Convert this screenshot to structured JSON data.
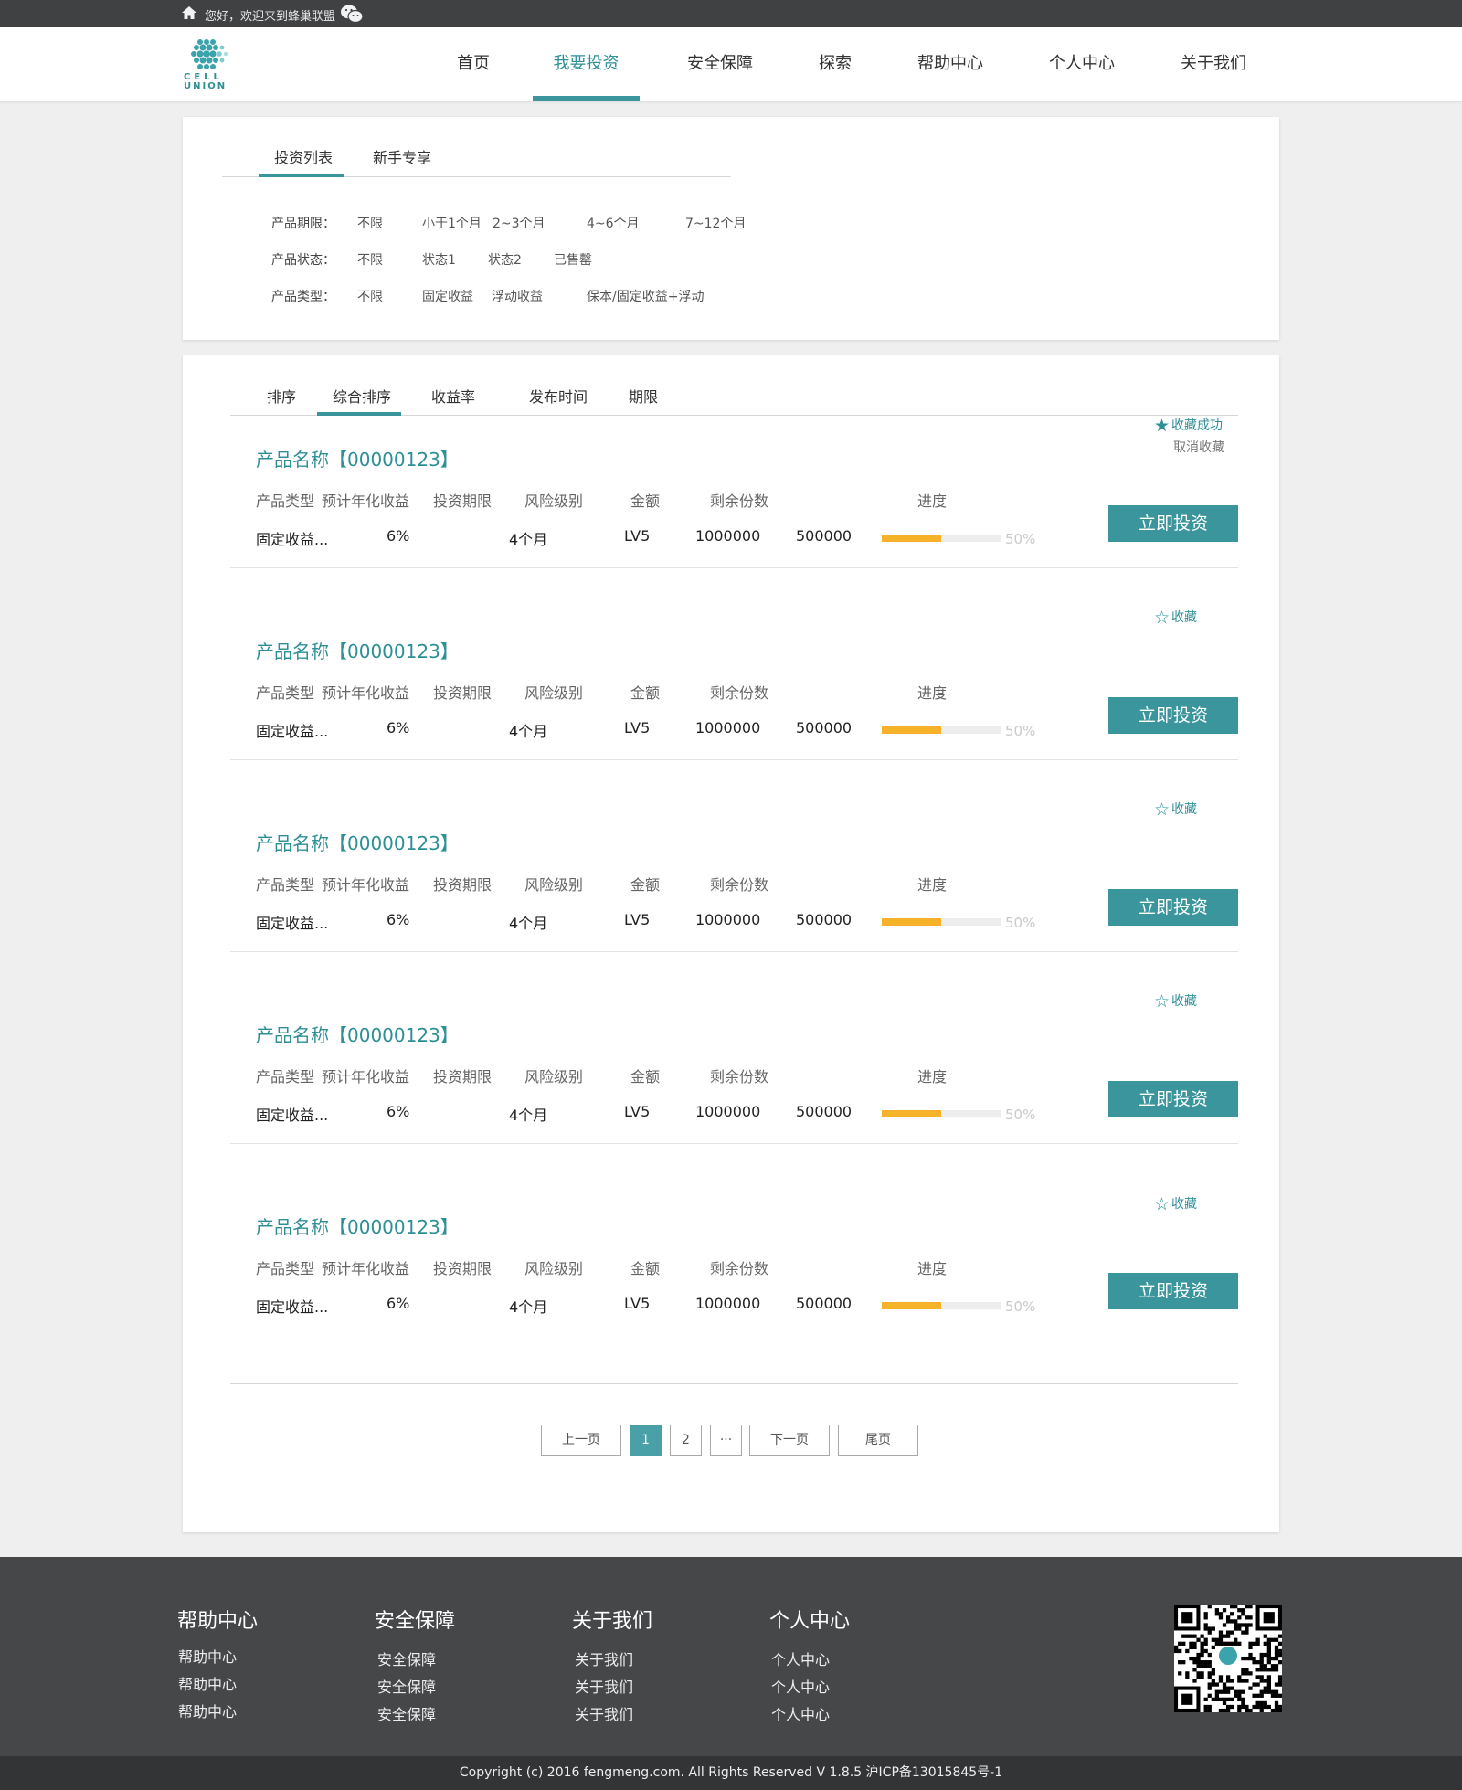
{
  "topbar": {
    "welcome": "您好，欢迎来到蜂巢联盟"
  },
  "logo": {
    "line1": "CELL",
    "line2": "UNION"
  },
  "nav": [
    {
      "label": "首页"
    },
    {
      "label": "我要投资"
    },
    {
      "label": "安全保障"
    },
    {
      "label": "探索"
    },
    {
      "label": "帮助中心"
    },
    {
      "label": "个人中心"
    },
    {
      "label": "关于我们"
    }
  ],
  "filter": {
    "tabs": [
      "投资列表",
      "新手专享"
    ],
    "rows": [
      {
        "label": "产品期限：",
        "options": [
          "不限",
          "小于1个月",
          "2~3个月",
          "4~6个月",
          "7~12个月"
        ]
      },
      {
        "label": "产品状态：",
        "options": [
          "不限",
          "状态1",
          "状态2",
          "已售罄"
        ]
      },
      {
        "label": "产品类型：",
        "options": [
          "不限",
          "固定收益",
          "浮动收益",
          "保本/固定收益+浮动"
        ]
      }
    ]
  },
  "sort": {
    "tabs": [
      "排序",
      "综合排序",
      "收益率",
      "发布时间",
      "期限"
    ]
  },
  "columns": [
    "产品类型",
    "预计年化收益",
    "投资期限",
    "风险级别",
    "金额",
    "剩余份数",
    "进度"
  ],
  "favorite": {
    "collected": "收藏成功",
    "cancel": "取消收藏",
    "label": "收藏"
  },
  "invest_label": "立即投资",
  "products": [
    {
      "title": "产品名称【00000123】",
      "type": "固定收益...",
      "rate": "6%",
      "term": "4个月",
      "risk": "LV5",
      "amount": "1000000",
      "remaining": "500000",
      "progress": 0.5,
      "progress_text": "50%",
      "favorited": true
    },
    {
      "title": "产品名称【00000123】",
      "type": "固定收益...",
      "rate": "6%",
      "term": "4个月",
      "risk": "LV5",
      "amount": "1000000",
      "remaining": "500000",
      "progress": 0.5,
      "progress_text": "50%",
      "favorited": false
    },
    {
      "title": "产品名称【00000123】",
      "type": "固定收益...",
      "rate": "6%",
      "term": "4个月",
      "risk": "LV5",
      "amount": "1000000",
      "remaining": "500000",
      "progress": 0.5,
      "progress_text": "50%",
      "favorited": false
    },
    {
      "title": "产品名称【00000123】",
      "type": "固定收益...",
      "rate": "6%",
      "term": "4个月",
      "risk": "LV5",
      "amount": "1000000",
      "remaining": "500000",
      "progress": 0.5,
      "progress_text": "50%",
      "favorited": false
    },
    {
      "title": "产品名称【00000123】",
      "type": "固定收益...",
      "rate": "6%",
      "term": "4个月",
      "risk": "LV5",
      "amount": "1000000",
      "remaining": "500000",
      "progress": 0.5,
      "progress_text": "50%",
      "favorited": false
    }
  ],
  "pagination": {
    "prev": "上一页",
    "page1": "1",
    "page2": "2",
    "ellipsis": "···",
    "next": "下一页",
    "last": "尾页"
  },
  "footer": {
    "columns": [
      {
        "title": "帮助中心",
        "links": [
          "帮助中心",
          "帮助中心",
          "帮助中心"
        ]
      },
      {
        "title": "安全保障",
        "links": [
          "安全保障",
          "安全保障",
          "安全保障"
        ]
      },
      {
        "title": "关于我们",
        "links": [
          "关于我们",
          "关于我们",
          "关于我们"
        ]
      },
      {
        "title": "个人中心",
        "links": [
          "个人中心",
          "个人中心",
          "个人中心"
        ]
      }
    ],
    "copyright": "Copyright (c) 2016 fengmeng.com. All Rights Reserved V 1.8.5 沪ICP备13015845号-1"
  },
  "colors": {
    "accent": "#3a959c",
    "progress": "#f6b228",
    "topbar": "#3f4143",
    "footer": "#464749"
  }
}
